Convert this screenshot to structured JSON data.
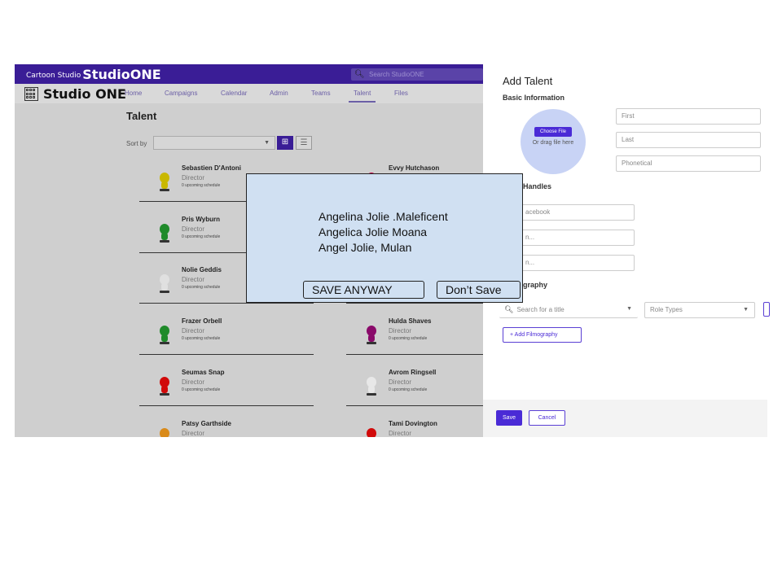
{
  "app": {
    "brand_small_prefix": "Cartoon Studio",
    "brand_small": "StudioONE",
    "search_placeholder": "Search StudioONE",
    "brand": "Studio ONE",
    "nav": [
      "Home",
      "Campaigns",
      "Calendar",
      "Admin",
      "Teams",
      "Talent",
      "Files"
    ],
    "active_nav": "Talent",
    "page_title": "Talent",
    "sort_label": "Sort by"
  },
  "talent_cards": [
    {
      "name": "Sebastien D'Antoni",
      "role": "Director",
      "schedule": "0 upcoming schedule",
      "color": "#c9b800"
    },
    {
      "name": "Evvy Hutchason",
      "role": "Director",
      "schedule": "0 upcoming schedule",
      "color": "#c8004a"
    },
    {
      "name": "Pris Wyburn",
      "role": "Director",
      "schedule": "0 upcoming schedule",
      "color": "#1f8a2a"
    },
    {
      "name": "",
      "role": "",
      "schedule": "",
      "color": "#aaaaaa"
    },
    {
      "name": "Nolie Geddis",
      "role": "Director",
      "schedule": "0 upcoming schedule",
      "color": "#e0e0e0"
    },
    {
      "name": "",
      "role": "",
      "schedule": "",
      "color": "#aaaaaa"
    },
    {
      "name": "Frazer Orbell",
      "role": "Director",
      "schedule": "0 upcoming schedule",
      "color": "#1f8a2a"
    },
    {
      "name": "Hulda Shaves",
      "role": "Director",
      "schedule": "0 upcoming schedule",
      "color": "#8a0a6a"
    },
    {
      "name": "Seumas Snap",
      "role": "Director",
      "schedule": "0 upcoming schedule",
      "color": "#d10a0a"
    },
    {
      "name": "Avrom Ringsell",
      "role": "Director",
      "schedule": "0 upcoming schedule",
      "color": "#e8e8e8"
    },
    {
      "name": "Patsy Garthside",
      "role": "Director",
      "schedule": "",
      "color": "#d98a1a"
    },
    {
      "name": "Tami Dovington",
      "role": "Director",
      "schedule": "",
      "color": "#d10a0a"
    }
  ],
  "panel": {
    "title": "Add Talent",
    "basic_info": "Basic Information",
    "choose_file": "Choose File",
    "drag_text": "Or drag file here",
    "first_placeholder": "First",
    "last_placeholder": "Last",
    "phonetical_placeholder": "Phonetical",
    "social_handles": "l Handles",
    "facebook_placeholder": "acebook",
    "social2_placeholder": "n...",
    "social3_placeholder": "n...",
    "filmography": "graphy",
    "title_search_placeholder": "Search for a title",
    "role_types_placeholder": "Role Types",
    "add_filmography": "+  Add Filmography",
    "save": "Save",
    "cancel": "Cancel"
  },
  "dialog": {
    "lines": [
      "Angelina Jolie .Maleficent",
      "Angelica Jolie Moana",
      "Angel Jolie, Mulan"
    ],
    "save_anyway": "SAVE ANYWAY",
    "dont_save": "Don’t Save"
  },
  "colors": {
    "brand_purple": "#3a1d96",
    "accent": "#4a2bd6",
    "dialog_bg": "#d0e0f2"
  }
}
